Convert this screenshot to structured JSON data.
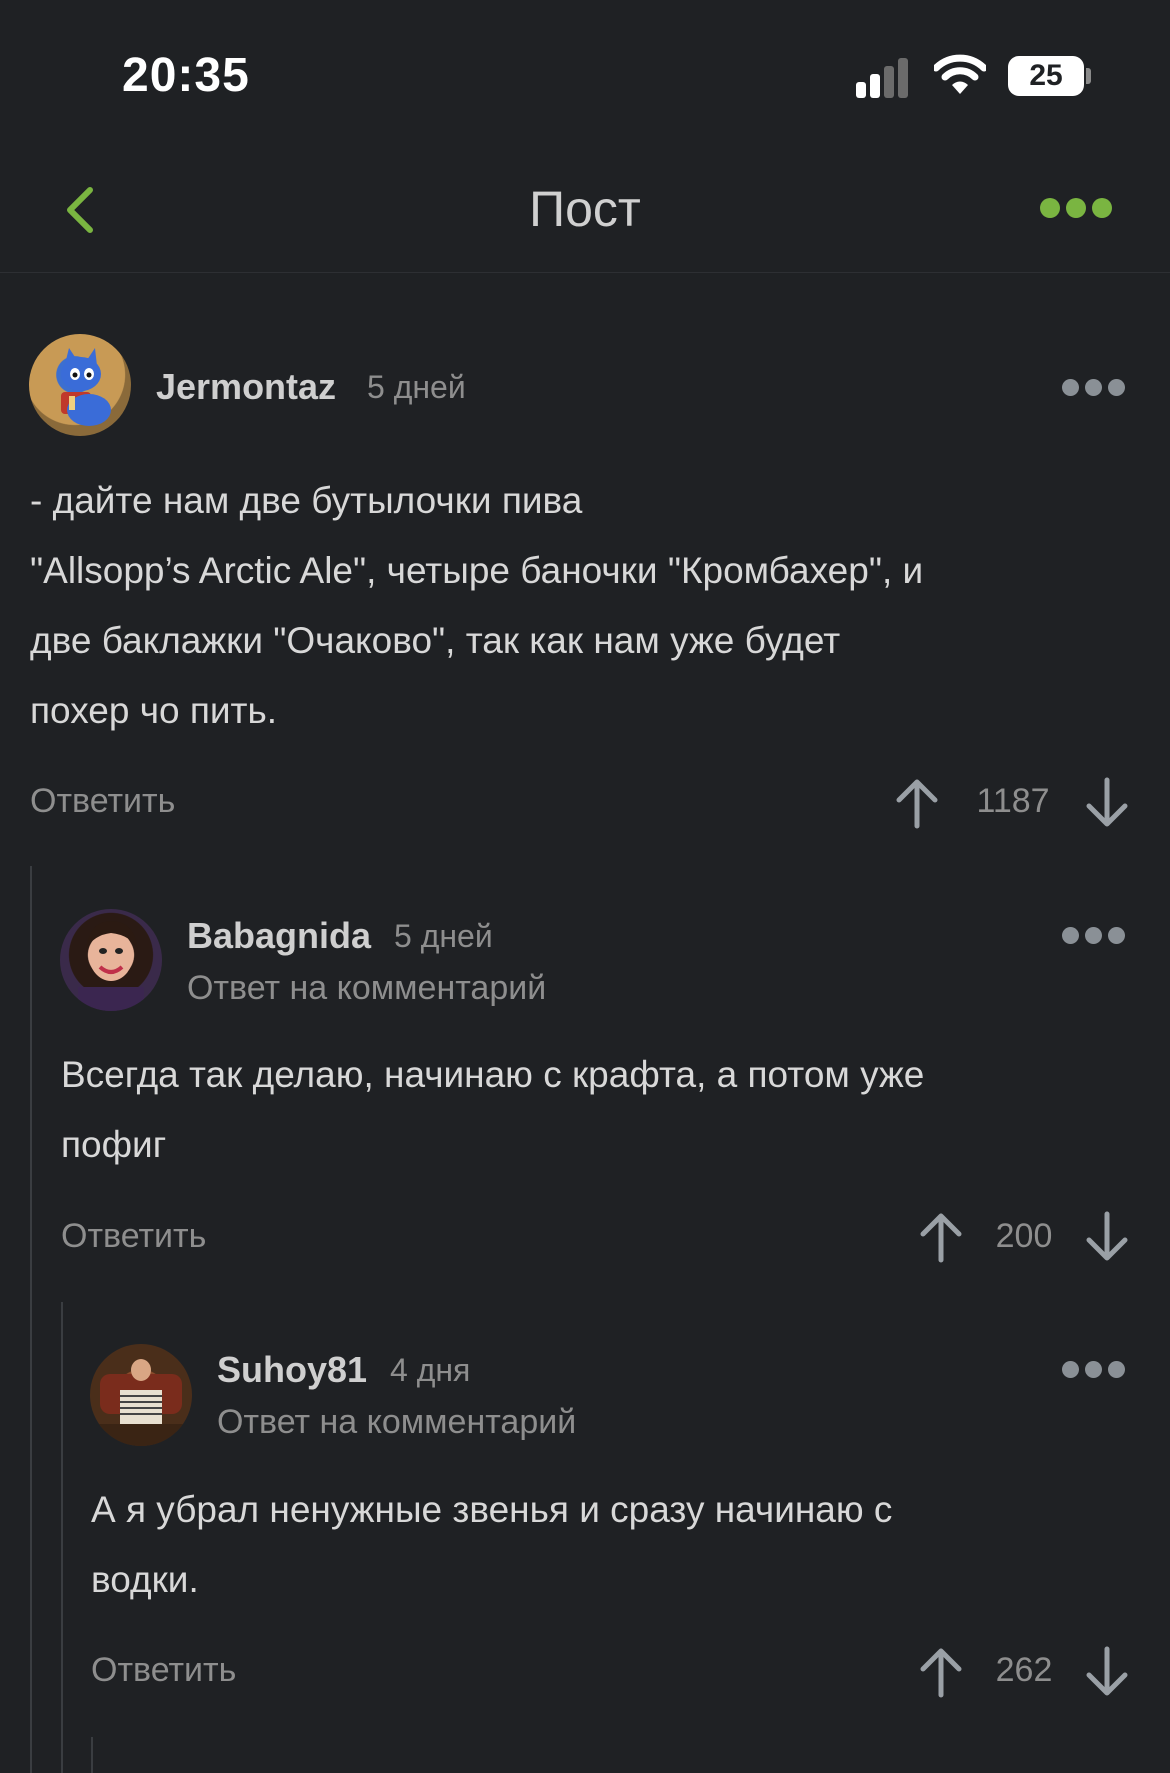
{
  "status_bar": {
    "time": "20:35",
    "battery": "25"
  },
  "nav": {
    "title": "Пост"
  },
  "comments": [
    {
      "username": "Jermontaz",
      "time": "5 дней",
      "reply_to": "",
      "text_lines": [
        "- дайте нам две бутылочки пива",
        "\"Allsopp’s Arctic Ale\", четыре баночки \"Кромбахер\", и",
        "две баклажки \"Очаково\", так как нам уже будет",
        "похер чо пить."
      ],
      "reply_label": "Ответить",
      "score": "1187"
    },
    {
      "username": "Babagnida",
      "time": "5 дней",
      "reply_to": "Ответ на комментарий",
      "text_lines": [
        "Всегда так делаю, начинаю с крафта, а потом уже",
        "пофиг"
      ],
      "reply_label": "Ответить",
      "score": "200"
    },
    {
      "username": "Suhoy81",
      "time": "4 дня",
      "reply_to": "Ответ на комментарий",
      "text_lines": [
        "А я убрал ненужные звенья и сразу начинаю с",
        "водки."
      ],
      "reply_label": "Ответить",
      "score": "262"
    }
  ],
  "colors": {
    "accent": "#7ab541",
    "background": "#1f2124",
    "muted": "#8e8e8e"
  }
}
